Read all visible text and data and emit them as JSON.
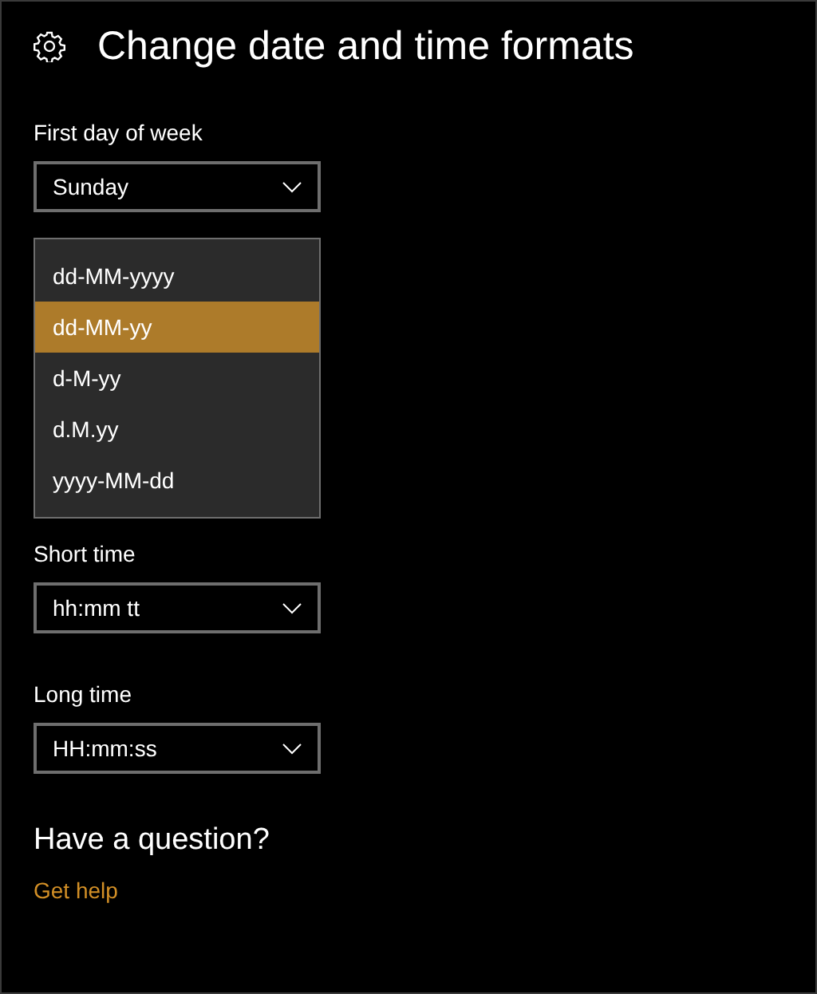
{
  "page": {
    "title": "Change date and time formats"
  },
  "fields": [
    {
      "kind": "select",
      "label": "First day of week",
      "value": "Sunday"
    },
    {
      "kind": "open_list",
      "options": [
        {
          "label": "dd-MM-yyyy",
          "selected": false
        },
        {
          "label": "dd-MM-yy",
          "selected": true
        },
        {
          "label": "d-M-yy",
          "selected": false
        },
        {
          "label": "d.M.yy",
          "selected": false
        },
        {
          "label": "yyyy-MM-dd",
          "selected": false
        }
      ]
    },
    {
      "kind": "select",
      "label": "Short time",
      "value": "hh:mm tt"
    },
    {
      "kind": "select",
      "label": "Long time",
      "value": "HH:mm:ss"
    }
  ],
  "help": {
    "heading": "Have a question?",
    "link": "Get help"
  }
}
